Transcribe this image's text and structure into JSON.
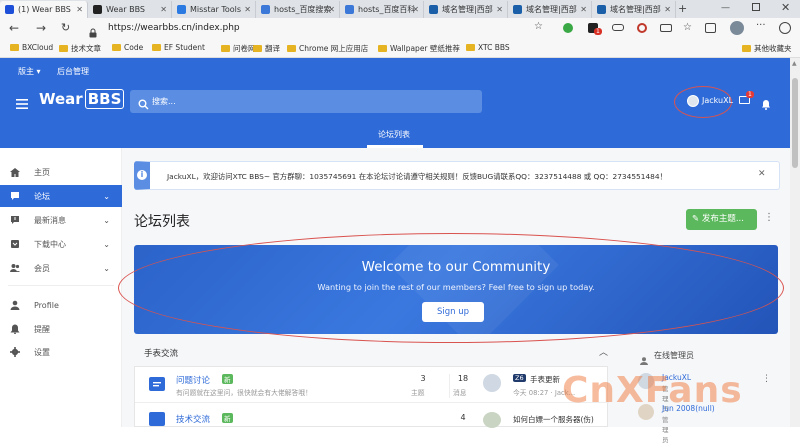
{
  "browser": {
    "tabs": [
      {
        "label": "(1) Wear BBS",
        "active": true,
        "color": "#1e4fd8"
      },
      {
        "label": "Wear BBS",
        "active": false,
        "color": "#222222"
      },
      {
        "label": "Misstar Tools",
        "active": false,
        "color": "#2a7ae2"
      },
      {
        "label": "hosts_百度搜索",
        "active": false,
        "color": "#3c78d8"
      },
      {
        "label": "hosts_百度百科",
        "active": false,
        "color": "#3c78d8"
      },
      {
        "label": "域名管理|西部",
        "active": false,
        "color": "#1b5fa8"
      },
      {
        "label": "域名管理|西部",
        "active": false,
        "color": "#1b5fa8"
      },
      {
        "label": "域名管理|西部",
        "active": false,
        "color": "#1b5fa8"
      }
    ],
    "new_tab": "+",
    "url": "https://wearbbs.cn/index.php",
    "bookmarks": [
      {
        "label": "BXCloud"
      },
      {
        "label": "技术文章"
      },
      {
        "label": "Code"
      },
      {
        "label": "EF Student"
      },
      {
        "label": "问卷网"
      },
      {
        "label": "翻译"
      },
      {
        "label": "Chrome 网上应用店"
      },
      {
        "label": "Wallpaper 壁纸推荐"
      },
      {
        "label": "XTC BBS"
      }
    ],
    "other_bookmarks": "其他收藏夹",
    "ext_badge": "1"
  },
  "site": {
    "topnav": {
      "edition": "版主",
      "admin": "后台管理"
    },
    "logo_a": "Wear",
    "logo_b": "BBS",
    "search_placeholder": "搜索...",
    "user": "JackuXL",
    "msg_badge": "1",
    "subnav_tab": "论坛列表",
    "sidebar": [
      {
        "label": "主页",
        "icon": "home-icon"
      },
      {
        "label": "论坛",
        "icon": "chat-icon",
        "active": true,
        "chev": true
      },
      {
        "label": "最新消息",
        "icon": "alert-icon",
        "chev": true
      },
      {
        "label": "下载中心",
        "icon": "download-icon",
        "chev": true
      },
      {
        "label": "会员",
        "icon": "users-icon",
        "chev": true
      },
      {
        "label": "Profile",
        "icon": "person-icon"
      },
      {
        "label": "提醒",
        "icon": "bell-icon"
      },
      {
        "label": "设置",
        "icon": "gear-icon"
      }
    ],
    "notice": "JackuXL，欢迎访问XTC BBS~ 官方群聊：1035745691 在本论坛讨论请遵守相关规则！反馈BUG请联系QQ：3237514488 或 QQ：2734551484！",
    "page_title": "论坛列表",
    "post_btn": "发布主题...",
    "welcome_title": "Welcome to our Community",
    "welcome_sub": "Wanting to join the rest of our members? Feel free to sign up today.",
    "signup": "Sign up",
    "section": "手表交流",
    "online_title": "在线管理员",
    "rows": [
      {
        "title": "问题讨论",
        "tag": "新",
        "desc": "有问题就在这里问，很快就会有大佬解答哦！",
        "topics": "3",
        "topics_label": "主题",
        "posts": "18",
        "posts_label": "消息",
        "last_tag": "Z6",
        "last_title": "手表更新",
        "last_time": "今天 08:27 · Jack..."
      },
      {
        "title": "技术交流",
        "tag": "新",
        "desc": "",
        "topics": "",
        "topics_label": "",
        "posts": "4",
        "posts_label": "",
        "last_tag": "",
        "last_title": "如何白嫖一个服务器(伤)",
        "last_time": ""
      }
    ],
    "online_users": [
      {
        "name": "JackuXL",
        "role": "管理员"
      },
      {
        "name": "Jun 2008(null)",
        "role": "管理员"
      }
    ]
  },
  "watermark": "CnXFans"
}
